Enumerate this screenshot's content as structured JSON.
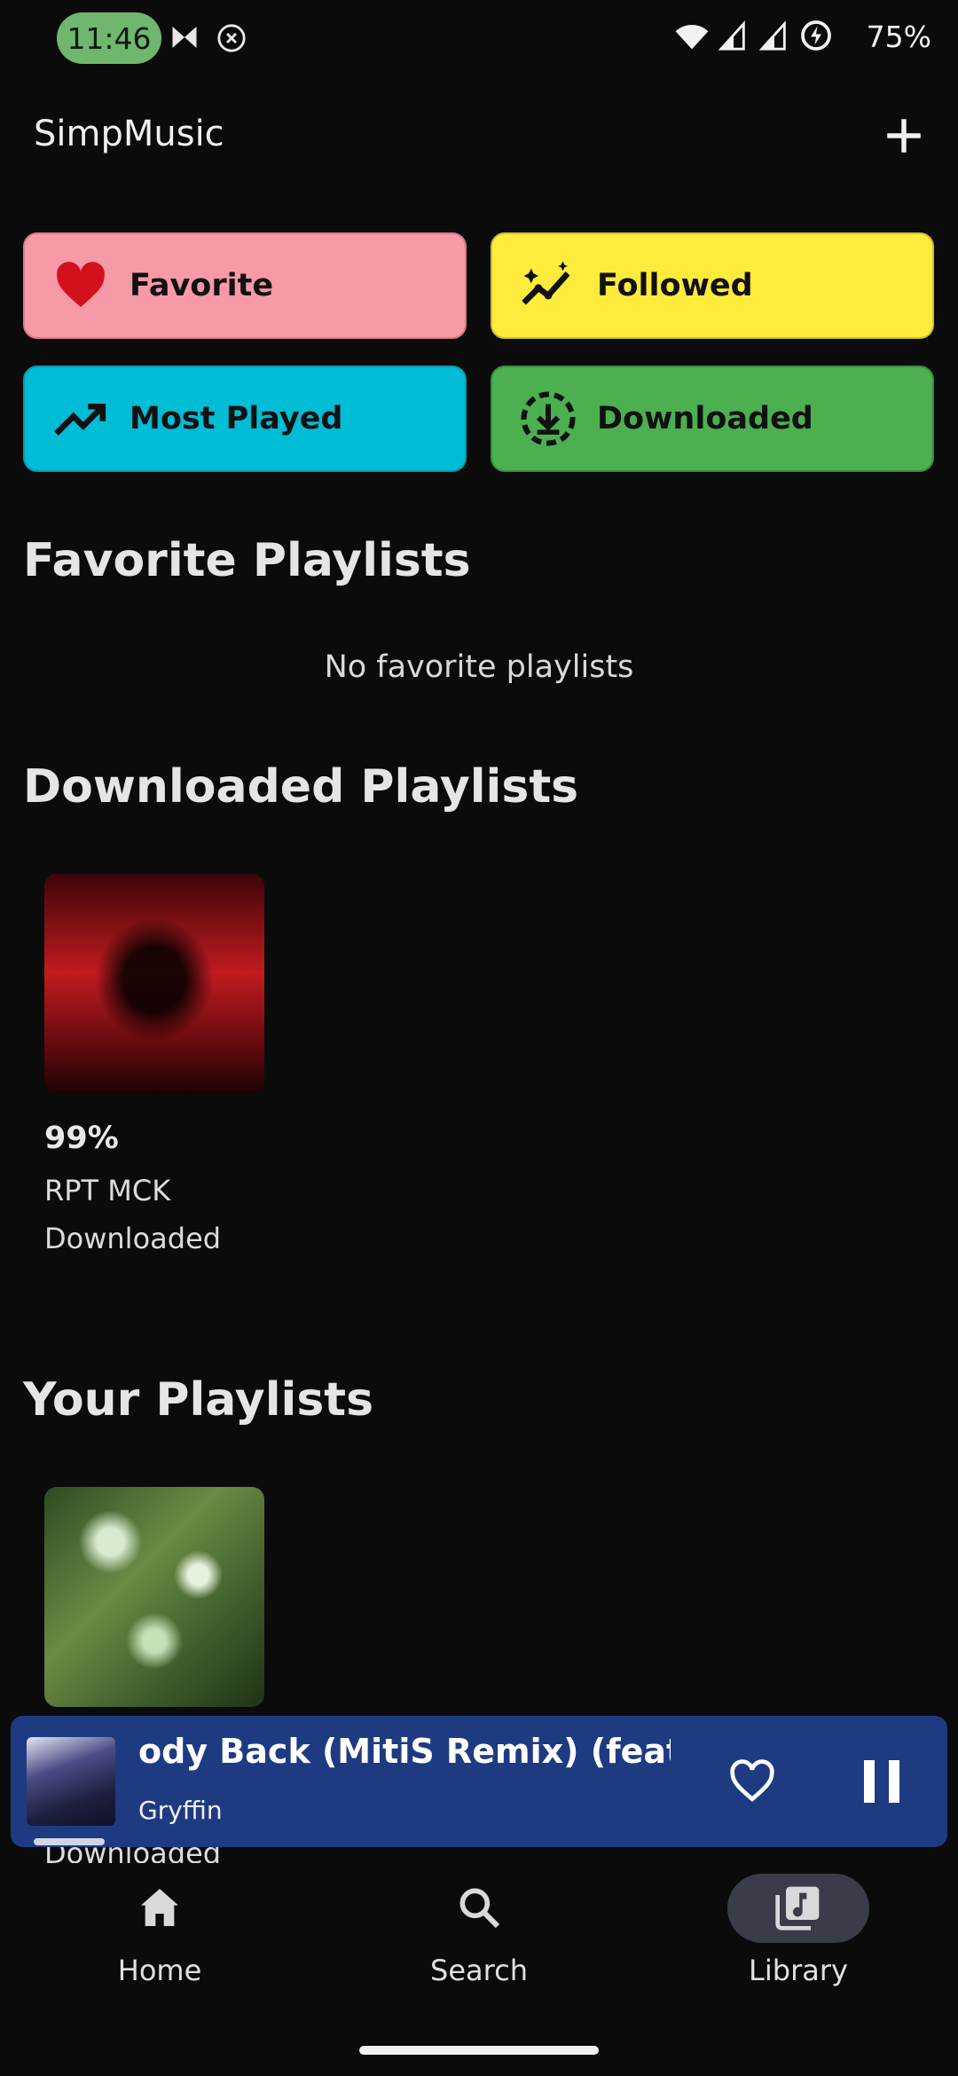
{
  "status_bar": {
    "time": "11:46",
    "battery": "75%"
  },
  "header": {
    "title": "SimpMusic",
    "add_icon": "plus-icon"
  },
  "quick_access": [
    {
      "label": "Favorite",
      "icon": "heart-icon",
      "color": "#f799a6"
    },
    {
      "label": "Followed",
      "icon": "insights-icon",
      "color": "#ffeb3b"
    },
    {
      "label": "Most Played",
      "icon": "trending-up-icon",
      "color": "#00bcd4"
    },
    {
      "label": "Downloaded",
      "icon": "download-circle-icon",
      "color": "#4caf50"
    }
  ],
  "favorite_playlists": {
    "title": "Favorite Playlists",
    "empty_text": "No favorite playlists"
  },
  "downloaded_playlists": {
    "title": "Downloaded Playlists",
    "items": [
      {
        "progress": "99%",
        "name": "RPT MCK",
        "status": "Downloaded"
      }
    ]
  },
  "your_playlists": {
    "title": "Your Playlists",
    "items": [
      {
        "status": "Downloaded"
      }
    ]
  },
  "mini_player": {
    "title": "ody Back (MitiS Remix) (feat. Mai",
    "artist": "Gryffin"
  },
  "bottom_nav": [
    {
      "label": "Home",
      "icon": "home-icon"
    },
    {
      "label": "Search",
      "icon": "search-icon"
    },
    {
      "label": "Library",
      "icon": "library-music-icon",
      "active": true
    }
  ]
}
